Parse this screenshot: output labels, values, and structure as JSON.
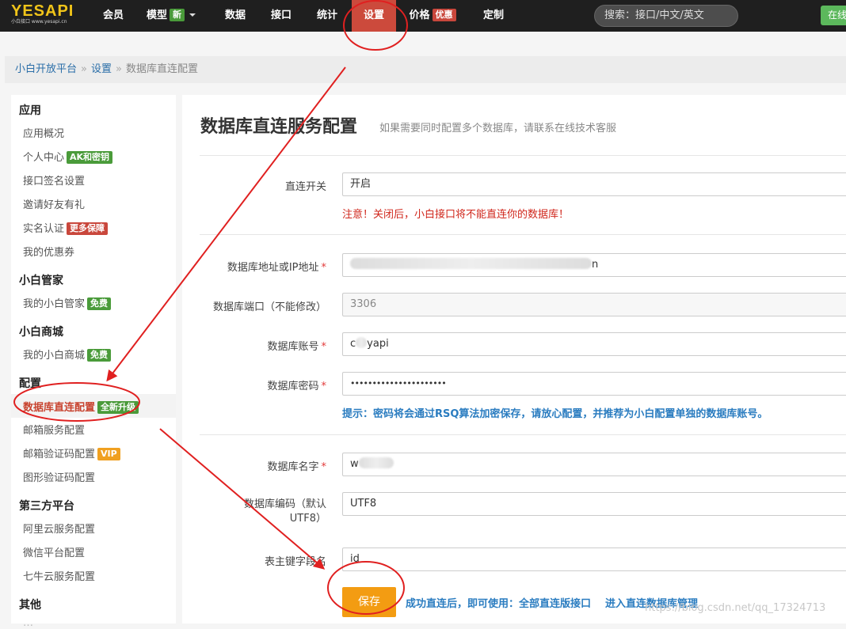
{
  "topbar": {
    "logo_text": "YESAPI",
    "logo_sub": "小白接口 www.yesapi.cn",
    "nav": [
      {
        "label": "会员"
      },
      {
        "label": "模型",
        "badge": "新"
      },
      {
        "label": "数据"
      },
      {
        "label": "接口"
      },
      {
        "label": "统计"
      },
      {
        "label": "设置"
      },
      {
        "label": "价格",
        "badge": "优惠"
      },
      {
        "label": "定制"
      }
    ],
    "search_placeholder": "搜索：接口/中文/英文",
    "right_button": "在线"
  },
  "breadcrumb": {
    "home": "小白开放平台",
    "parent": "设置",
    "current": "数据库直连配置"
  },
  "sidebar": {
    "groups": [
      {
        "title": "应用",
        "items": [
          {
            "label": "应用概况"
          },
          {
            "label": "个人中心",
            "badge": "AK和密钥"
          },
          {
            "label": "接口签名设置"
          },
          {
            "label": "邀请好友有礼"
          },
          {
            "label": "实名认证",
            "badge": "更多保障"
          },
          {
            "label": "我的优惠券"
          }
        ]
      },
      {
        "title": "小白管家",
        "items": [
          {
            "label": "我的小白管家",
            "badge": "免费"
          }
        ]
      },
      {
        "title": "小白商城",
        "items": [
          {
            "label": "我的小白商城",
            "badge": "免费"
          }
        ]
      },
      {
        "title": "配置",
        "items": [
          {
            "label": "数据库直连配置",
            "badge": "全新升级"
          },
          {
            "label": "邮箱服务配置"
          },
          {
            "label": "邮箱验证码配置",
            "badge": "VIP"
          },
          {
            "label": "图形验证码配置"
          }
        ]
      },
      {
        "title": "第三方平台",
        "items": [
          {
            "label": "阿里云服务配置"
          },
          {
            "label": "微信平台配置"
          },
          {
            "label": "七牛云服务配置"
          }
        ]
      },
      {
        "title": "其他",
        "items": [
          {
            "label": "…"
          }
        ]
      }
    ]
  },
  "main": {
    "title": "数据库直连服务配置",
    "subtitle": "如果需要同时配置多个数据库，请联系在线技术客服",
    "switch": {
      "label": "直连开关",
      "value": "开启",
      "warning": "注意！关闭后，小白接口将不能直连你的数据库！"
    },
    "host": {
      "label": "数据库地址或IP地址",
      "value_tail": "n"
    },
    "port": {
      "label": "数据库端口（不能修改）",
      "value": "3306"
    },
    "account": {
      "label": "数据库账号",
      "value_head": "c",
      "value_tail": "yapi"
    },
    "password": {
      "label": "数据库密码",
      "value": "••••••••••••••••••••••",
      "tip": "提示：密码将会通过RSQ算法加密保存，请放心配置，并推荐为小白配置单独的数据库账号。"
    },
    "dbname": {
      "label": "数据库名字",
      "value_head": "w"
    },
    "encoding": {
      "label_line1": "数据库编码（默认",
      "label_line2": "UTF8）",
      "value": "UTF8"
    },
    "pk": {
      "label": "表主键字段名",
      "value": "id"
    },
    "save_label": "保存",
    "after_save": "成功直连后，即可使用：",
    "link_api": "全部直连版接口",
    "link_manage": "进入直连数据库管理"
  },
  "watermark": "https://blog.csdn.net/qq_17324713",
  "colors": {
    "topbar_bg": "#1f1f1f",
    "nav_active": "#cc4a3c",
    "badge_green": "#4a9b3a",
    "badge_red": "#c9473c",
    "badge_vip": "#f0a020",
    "save_button": "#f39c12",
    "link_blue": "#2a7cc0",
    "warning_red": "#d0271c",
    "annotation_red": "#e02020"
  }
}
